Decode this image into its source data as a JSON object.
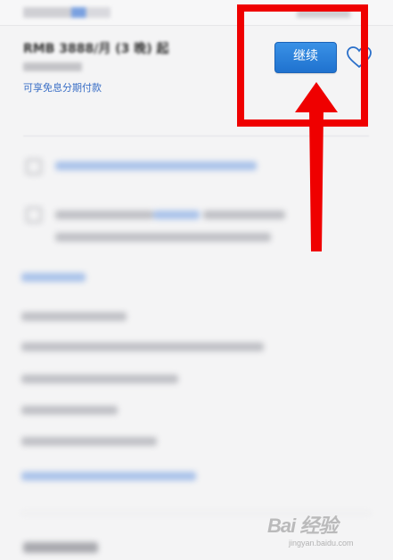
{
  "header": {
    "price_text": "RMB 3888/月 (3 晚) 起",
    "offer_text": "可享免息分期付款"
  },
  "actions": {
    "continue_label": "继续"
  },
  "watermark": {
    "logo_text": "Bai 经验",
    "url_text": "jingyan.baidu.com"
  },
  "colors": {
    "button_blue": "#2a80dc",
    "annotation_red": "#ef0000",
    "link_blue": "#3b6fc6"
  }
}
